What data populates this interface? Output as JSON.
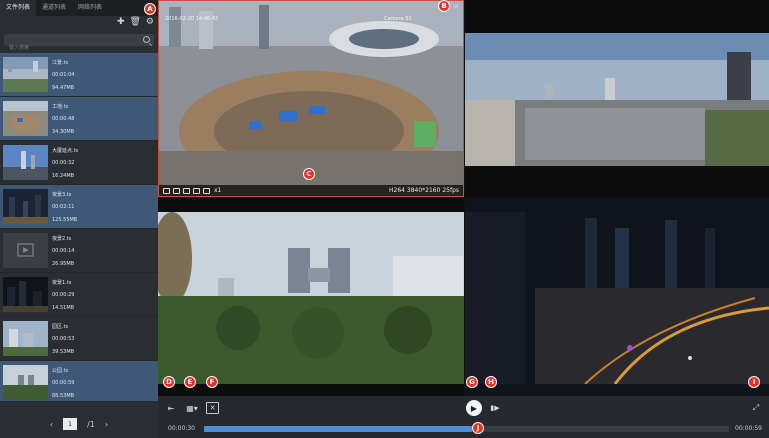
{
  "sidebar": {
    "tabs": [
      "文件列表",
      "通道列表",
      "网络列表"
    ],
    "search_placeholder": "键入搜索",
    "files": [
      {
        "name": "江景.ts",
        "duration": "00:01:04",
        "size": "94.47MB",
        "thumb": "river-thumb"
      },
      {
        "name": "工地.ts",
        "duration": "00:00:48",
        "size": "34.30MB",
        "thumb": "site-thumb"
      },
      {
        "name": "大厦延点.ts",
        "duration": "00:00:32",
        "size": "16.24MB",
        "thumb": "tower-thumb"
      },
      {
        "name": "夜景3.ts",
        "duration": "00:02:11",
        "size": "125.55MB",
        "thumb": "night-thumb"
      },
      {
        "name": "夜景2.ts",
        "duration": "00:00:14",
        "size": "26.95MB",
        "thumb": "placeholder-thumb"
      },
      {
        "name": "夜景1.ts",
        "duration": "00:00:29",
        "size": "14.51MB",
        "thumb": "night-thumb"
      },
      {
        "name": "园区.ts",
        "duration": "00:00:53",
        "size": "39.53MB",
        "thumb": "park-thumb"
      },
      {
        "name": "公园.ts",
        "duration": "00:00:59",
        "size": "86.53MB",
        "thumb": "garden-thumb"
      }
    ],
    "pager": {
      "current": "1",
      "total": "/1"
    }
  },
  "panes": {
    "pane1": {
      "osd_time": "2016-02-20 14:46:42",
      "osd_label": "Camera 01",
      "speed": "x1",
      "codec": "H264 3840*2160 25fps"
    }
  },
  "controls": {
    "time_current": "00:00:30",
    "time_total": "00:00:59",
    "progress": 0.51
  },
  "markers": [
    "A",
    "B",
    "C",
    "D",
    "E",
    "F",
    "G",
    "H",
    "I",
    "J"
  ],
  "colors": {
    "accent": "#4b8fdc",
    "selected_row": "#3f5877",
    "marker": "#e0322a"
  }
}
